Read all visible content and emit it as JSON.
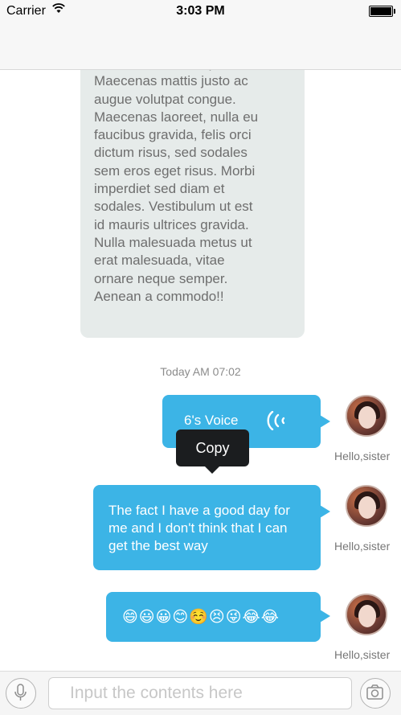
{
  "status_bar": {
    "carrier": "Carrier",
    "time": "3:03 PM"
  },
  "chat": {
    "long_message": "massa viverra semper.\nMaecenas mattis justo ac\naugue volutpat congue.\nMaecenas laoreet, nulla eu\nfaucibus gravida, felis orci\ndictum risus, sed sodales\nsem eros eget risus. Morbi\nimperdiet sed diam et\nsodales. Vestibulum ut est\nid mauris ultrices gravida.\nNulla malesuada metus ut\nerat malesuada, vitae\nornare neque semper.\nAenean a commodo!!",
    "timestamp": "Today AM 07:02",
    "voice_message": "6's Voice",
    "copy_menu_label": "Copy",
    "text_message": "The fact I have a good day for me and I don't think that I can get the best way",
    "emoji_message": "😄😃😀😊☺️😣😜😂😂",
    "sender_names": [
      "Hello,sister",
      "Hello,sister",
      "Hello,sister"
    ]
  },
  "input_bar": {
    "placeholder": "Input the contents here"
  },
  "icons": {
    "wifi": "wifi-icon",
    "battery": "battery-icon",
    "mic": "microphone-icon",
    "camera": "camera-icon",
    "voice": "voice-wave-icon"
  },
  "colors": {
    "bubble_blue": "#3cb4e6",
    "incoming_bubble": "#e6ebea",
    "tooltip": "#1b1d1f"
  }
}
